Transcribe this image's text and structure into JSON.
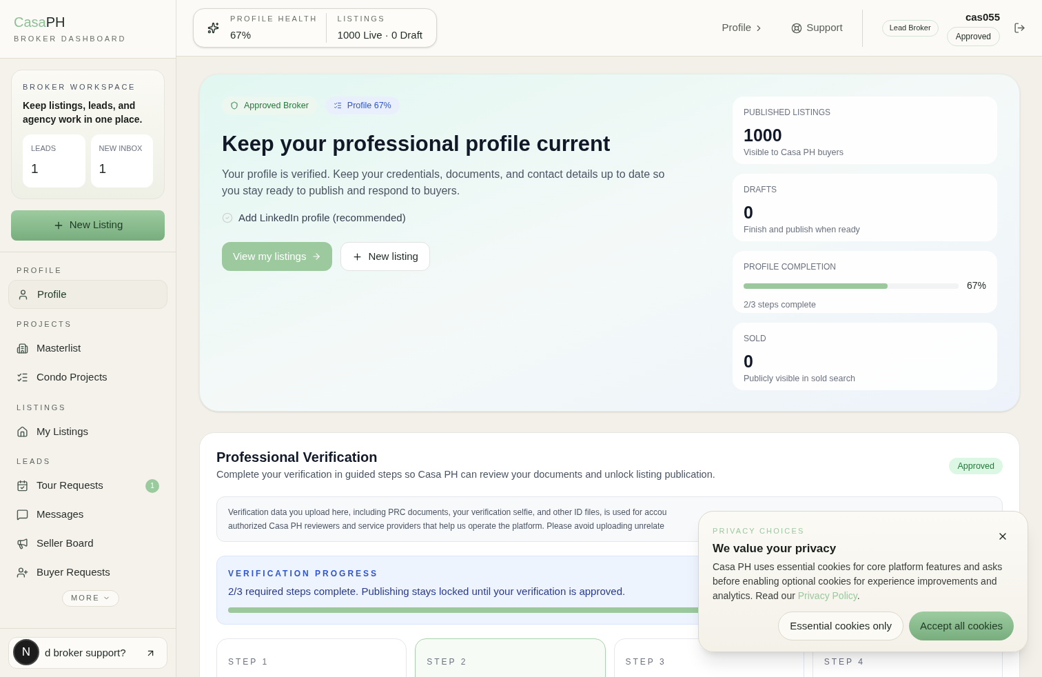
{
  "brand": {
    "name_part1": "Casa",
    "name_part2": "PH",
    "subtitle": "BROKER DASHBOARD"
  },
  "header": {
    "health_label": "PROFILE HEALTH",
    "health_value": "67%",
    "listings_label": "LISTINGS",
    "listings_value": "1000 Live · 0 Draft",
    "nav": [
      "Profile",
      "Support"
    ],
    "role_badge": "Lead Broker",
    "username": "cas055",
    "status_badge": "Approved"
  },
  "workspace": {
    "eyebrow": "BROKER WORKSPACE",
    "text": "Keep listings, leads, and agency work in one place.",
    "stats": [
      {
        "label": "LEADS",
        "value": "1"
      },
      {
        "label": "NEW INBOX",
        "value": "1"
      }
    ]
  },
  "new_listing_button": "New Listing",
  "sidebar": [
    {
      "heading": "PROFILE",
      "items": [
        {
          "kind": "user",
          "label": "Profile",
          "selected": true
        }
      ]
    },
    {
      "heading": "PROJECTS",
      "items": [
        {
          "kind": "building",
          "label": "Masterlist",
          "selected": false
        },
        {
          "kind": "checklist",
          "label": "Condo Projects",
          "selected": false
        }
      ]
    },
    {
      "heading": "LISTINGS",
      "items": [
        {
          "kind": "house",
          "label": "My Listings",
          "selected": false
        }
      ]
    },
    {
      "heading": "LEADS",
      "items": [
        {
          "kind": "calendar",
          "label": "Tour Requests",
          "selected": false,
          "badge": "1"
        },
        {
          "kind": "message",
          "label": "Messages",
          "selected": false
        },
        {
          "kind": "megaphone",
          "label": "Seller Board",
          "selected": false
        },
        {
          "kind": "user-plus",
          "label": "Buyer Requests",
          "selected": false
        }
      ]
    }
  ],
  "more_button": "MORE",
  "support_button": "d broker support?",
  "avatar_letter": "N",
  "hero": {
    "badges": [
      {
        "kind": "shield",
        "label": "Approved Broker"
      },
      {
        "kind": "list",
        "label": "Profile 67%"
      }
    ],
    "title": "Keep your professional profile current",
    "text": "Your profile is verified. Keep your credentials, documents, and contact details up to date so you stay ready to publish and respond to buyers.",
    "checklist": [
      {
        "label": "Add LinkedIn profile (recommended)",
        "checked": false
      }
    ],
    "primary_button": "View my listings",
    "secondary_button": "New listing",
    "stats": [
      {
        "kind": "number",
        "label": "PUBLISHED LISTINGS",
        "value": "1000",
        "note": "Visible to Casa PH buyers"
      },
      {
        "kind": "number",
        "label": "DRAFTS",
        "value": "0",
        "note": "Finish and publish when ready"
      },
      {
        "kind": "progress",
        "label": "PROFILE COMPLETION",
        "level": 0.67,
        "value": "67%",
        "note": "2/3 steps complete"
      },
      {
        "kind": "number",
        "label": "SOLD",
        "value": "0",
        "note": "Publicly visible in sold search"
      }
    ]
  },
  "verification": {
    "title": "Professional Verification",
    "subtitle": "Complete your verification in guided steps so Casa PH can review your documents and unlock listing publication.",
    "status": "Approved",
    "notice_lines": [
      "Verification data you upload here, including PRC documents, your verification selfie, and other ID files, is used for accou",
      "authorized Casa PH reviewers and service providers that help us operate the platform. Please avoid uploading unrelate"
    ],
    "progress_label": "VERIFICATION PROGRESS",
    "progress_text": "2/3 required steps complete. Publishing stays locked until your verification is approved.",
    "progress": {
      "level": 0.67
    },
    "steps": [
      {
        "label": "STEP 1",
        "selected": false
      },
      {
        "label": "STEP 2",
        "selected": true
      },
      {
        "label": "STEP 3",
        "selected": false
      },
      {
        "label": "STEP 4",
        "selected": false
      }
    ]
  },
  "cookie": {
    "eyebrow": "PRIVACY CHOICES",
    "title": "We value your privacy",
    "text": "Casa PH uses essential cookies for core platform features and asks before enabling optional cookies for experience improvements and analytics. Read our",
    "link": "Privacy Policy",
    "after_link": ".",
    "buttons": [
      "Essential cookies only",
      "Accept all cookies"
    ]
  }
}
